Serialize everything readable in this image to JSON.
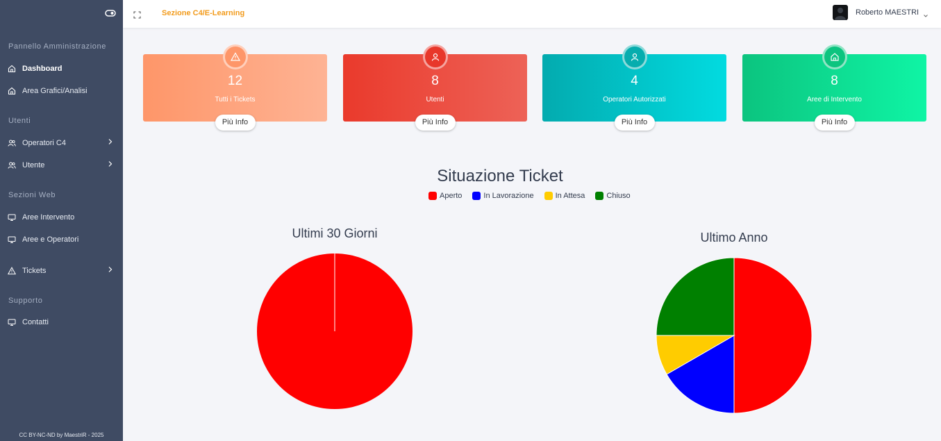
{
  "sidebar": {
    "sections": [
      "Pannello Amministrazione",
      "Utenti",
      "Sezioni Web",
      "Supporto"
    ],
    "items": [
      {
        "label": "Dashboard",
        "icon": "home-icon"
      },
      {
        "label": "Area Grafici/Analisi",
        "icon": "home-icon"
      },
      {
        "label": "Operatori C4",
        "icon": "users-icon"
      },
      {
        "label": "Utente",
        "icon": "users-icon"
      },
      {
        "label": "Aree Intervento",
        "icon": "monitor-icon"
      },
      {
        "label": "Aree e Operatori",
        "icon": "monitor-icon"
      },
      {
        "label": "Tickets",
        "icon": "warning-icon"
      },
      {
        "label": "Contatti",
        "icon": "monitor-icon"
      }
    ],
    "footer": "CC BY-NC-ND by MaestriR - 2025"
  },
  "header": {
    "section_title": "Sezione C4/E-Learning",
    "username": "Roberto MAESTRI"
  },
  "cards": [
    {
      "value": "12",
      "label": "Tutti i Tickets",
      "button": "Più Info",
      "icon": "warning-icon"
    },
    {
      "value": "8",
      "label": "Utenti",
      "button": "Più Info",
      "icon": "user-icon"
    },
    {
      "value": "4",
      "label": "Operatori Autorizzati",
      "button": "Più Info",
      "icon": "user-icon"
    },
    {
      "value": "8",
      "label": "Aree di Intervento",
      "button": "Più Info",
      "icon": "home-icon"
    }
  ],
  "chart_section": {
    "title": "Situazione Ticket",
    "legend": [
      "Aperto",
      "In Lavorazione",
      "In Attesa",
      "Chiuso"
    ]
  },
  "chart_data": [
    {
      "type": "pie",
      "title": "Ultimi 30 Giorni",
      "categories": [
        "Aperto",
        "In Lavorazione",
        "In Attesa",
        "Chiuso"
      ],
      "values": [
        1,
        0,
        0,
        0
      ],
      "colors": [
        "#ff0000",
        "#0000ff",
        "#ffcc00",
        "#008000"
      ]
    },
    {
      "type": "pie",
      "title": "Ultimo Anno",
      "categories": [
        "Aperto",
        "In Lavorazione",
        "In Attesa",
        "Chiuso"
      ],
      "values": [
        6,
        2,
        1,
        3
      ],
      "colors": [
        "#ff0000",
        "#0000ff",
        "#ffcc00",
        "#008000"
      ]
    }
  ]
}
